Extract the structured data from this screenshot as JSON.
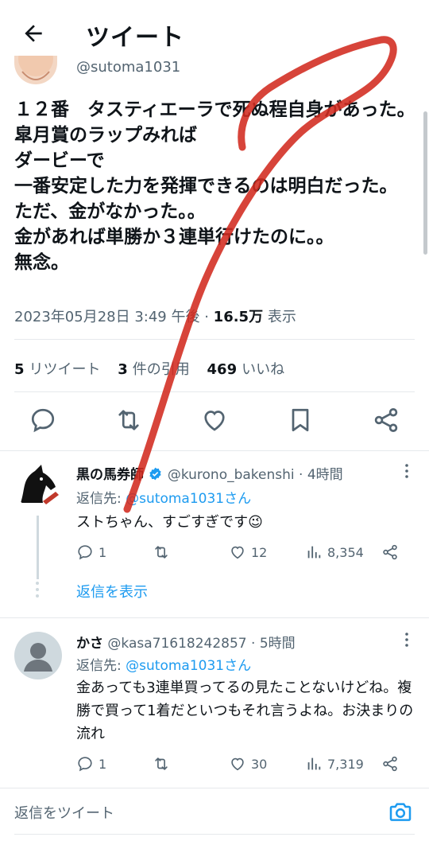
{
  "header": {
    "title": "ツイート"
  },
  "tweet": {
    "handle": "@sutoma1031",
    "text": "１２番　タスティエーラで死ぬ程自身があった。\n皐月賞のラップみれば\nダービーで\n一番安定した力を発揮できるのは明白だった。\nただ、金がなかった。。\n金があれば単勝か３連単行けたのに。。\n無念。",
    "timestamp": "2023年05月28日 3:49 午後",
    "views": "16.5万",
    "views_label": "表示",
    "retweets": "5",
    "retweets_label": "リツイート",
    "quotes": "3",
    "quotes_label": "件の引用",
    "likes": "469",
    "likes_label": "いいね"
  },
  "replies": [
    {
      "name": "黒の馬券師",
      "handle": "@kurono_bakenshi",
      "time": "4時間",
      "reply_prefix": "返信先:",
      "reply_to": "@sutoma1031さん",
      "text": "ストちゃん、すごすぎです😉",
      "comments": "1",
      "retweets": "",
      "likes": "12",
      "views": "8,354",
      "show_replies": "返信を表示"
    },
    {
      "name": "かさ",
      "handle": "@kasa71618242857",
      "time": "5時間",
      "reply_prefix": "返信先:",
      "reply_to": "@sutoma1031さん",
      "text": "金あっても3連単買ってるの見たことないけどね。複勝で買って1着だといつもそれ言うよね。お決まりの流れ",
      "comments": "1",
      "retweets": "",
      "likes": "30",
      "views": "7,319"
    }
  ],
  "composer": {
    "placeholder": "返信をツイート"
  },
  "colors": {
    "accent": "#1d9bf0",
    "verified": "#1d9bf0",
    "annotation": "#d12a1f",
    "text_secondary": "#536471"
  },
  "icons": [
    "back-arrow-icon",
    "comment-icon",
    "retweet-icon",
    "heart-icon",
    "bookmark-icon",
    "share-icon",
    "views-icon",
    "more-icon",
    "camera-icon",
    "verified-badge-icon"
  ]
}
